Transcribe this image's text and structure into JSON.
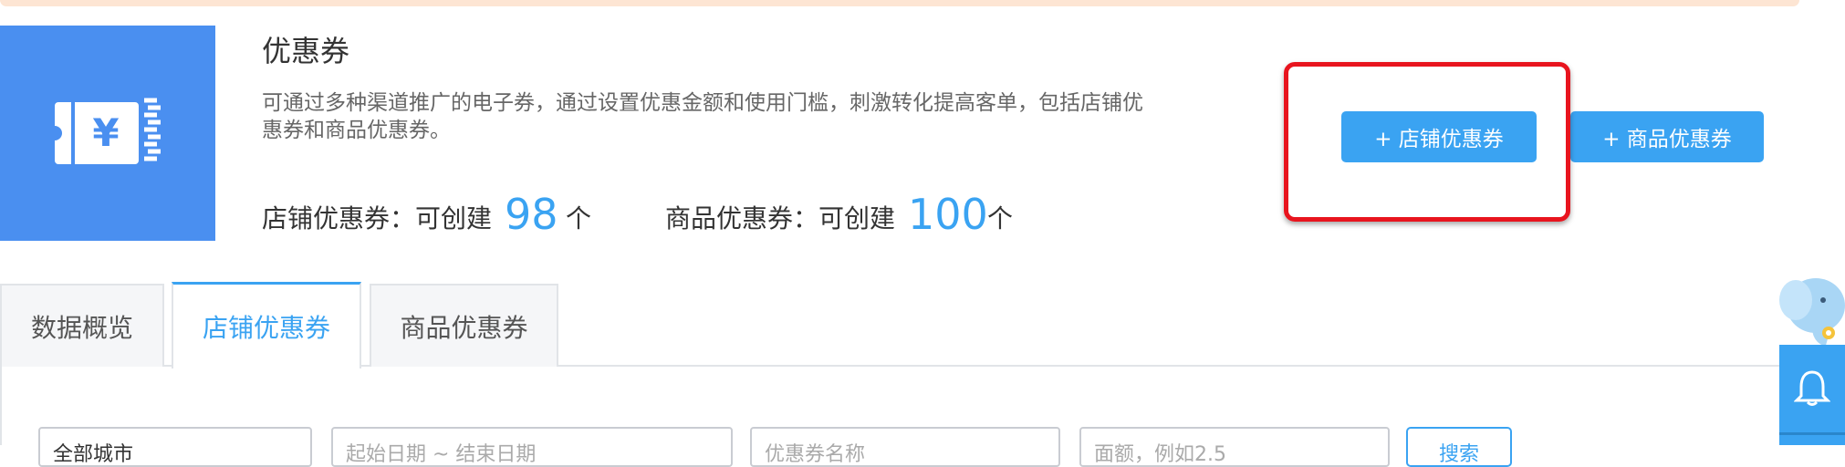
{
  "header": {
    "title": "优惠券",
    "description": "可通过多种渠道推广的电子券，通过设置优惠金额和使用门槛，刺激转化提高客单，包括店铺优惠券和商品优惠券。",
    "tile_icon": "coupon-yen-icon",
    "tile_icon_symbol": "¥"
  },
  "quota": {
    "store": {
      "label": "店铺优惠券：可创建",
      "count": "98",
      "unit": "个"
    },
    "product": {
      "label": "商品优惠券：可创建",
      "count": "100",
      "unit": "个"
    }
  },
  "actions": {
    "add_store_coupon": "+ 店铺优惠券",
    "add_product_coupon": "+ 商品优惠券"
  },
  "tabs": [
    {
      "label": "数据概览",
      "active": false
    },
    {
      "label": "店铺优惠券",
      "active": true
    },
    {
      "label": "商品优惠券",
      "active": false
    }
  ],
  "filters": {
    "city_select": "全部城市",
    "date_range": "起始日期  ~  结束日期",
    "coupon_name": "优惠券名称",
    "amount": "面额，例如2.5",
    "search_button": "搜索"
  },
  "colors": {
    "accent": "#3aa3f2",
    "tile": "#4a8ff0",
    "highlight": "#e8141e",
    "notice": "#fde5d3"
  },
  "side_dock": {
    "icon": "bell-icon",
    "mascot": "elephant-mascot-icon"
  }
}
